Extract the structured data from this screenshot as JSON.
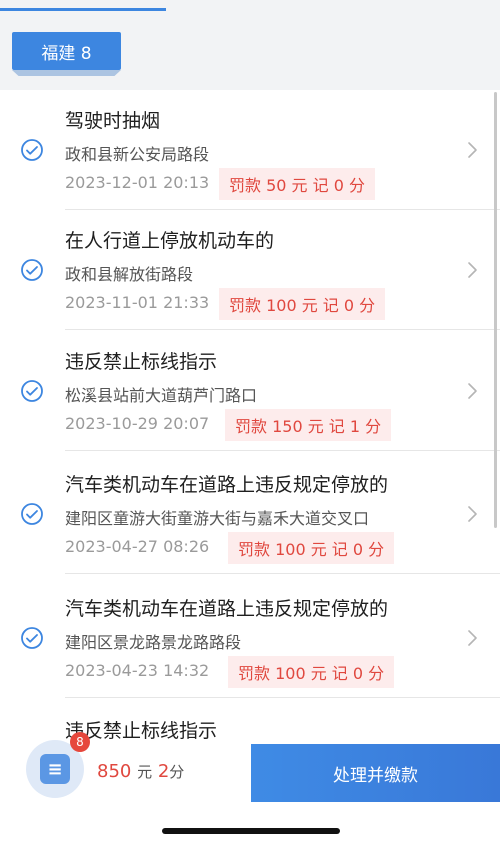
{
  "header": {
    "plate_tag": "福建 8"
  },
  "violations": [
    {
      "title": "驾驶时抽烟",
      "place": "政和县新公安局路段",
      "time": "2023-12-01 20:13",
      "fine": "罚款 50 元  记 0 分"
    },
    {
      "title": "在人行道上停放机动车的",
      "place": "政和县解放街路段",
      "time": "2023-11-01 21:33",
      "fine": "罚款 100 元  记 0 分"
    },
    {
      "title": "违反禁止标线指示",
      "place": "松溪县站前大道葫芦门路口",
      "time": "2023-10-29 20:07",
      "fine": "罚款 150 元  记 1 分"
    },
    {
      "title": "汽车类机动车在道路上违反规定停放的",
      "place": "建阳区童游大街童游大街与嘉禾大道交叉口",
      "time": "2023-04-27 08:26",
      "fine": "罚款 100 元  记 0 分"
    },
    {
      "title": "汽车类机动车在道路上违反规定停放的",
      "place": "建阳区景龙路景龙路路段",
      "time": "2023-04-23 14:32",
      "fine": "罚款 100 元  记 0 分"
    },
    {
      "title": "违反禁止标线指示",
      "place": "",
      "time": "",
      "fine": ""
    }
  ],
  "bottom_bar": {
    "badge_count": "8",
    "bill_icon_glyph": "≡",
    "total_amount": "850",
    "total_amount_unit": "元",
    "total_points": "2",
    "total_points_unit": "分",
    "pay_button_label": "处理并缴款"
  },
  "colors": {
    "accent": "#3d86e0",
    "fine_text": "#e0483f",
    "fine_bg": "#fdecec"
  }
}
